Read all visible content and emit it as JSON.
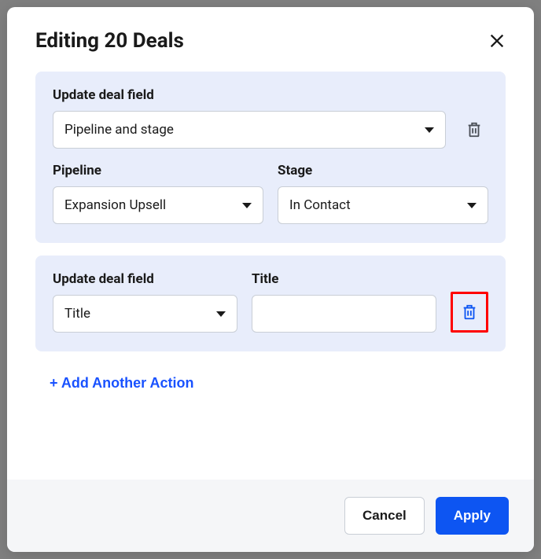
{
  "modal": {
    "title": "Editing 20 Deals"
  },
  "actions": [
    {
      "field_label": "Update deal field",
      "field_value": "Pipeline and stage",
      "sub": [
        {
          "label": "Pipeline",
          "value": "Expansion Upsell"
        },
        {
          "label": "Stage",
          "value": "In Contact"
        }
      ]
    },
    {
      "field_label": "Update deal field",
      "field_value": "Title",
      "title_label": "Title",
      "title_value": ""
    }
  ],
  "add_action_label": "+ Add Another Action",
  "footer": {
    "cancel": "Cancel",
    "apply": "Apply"
  }
}
